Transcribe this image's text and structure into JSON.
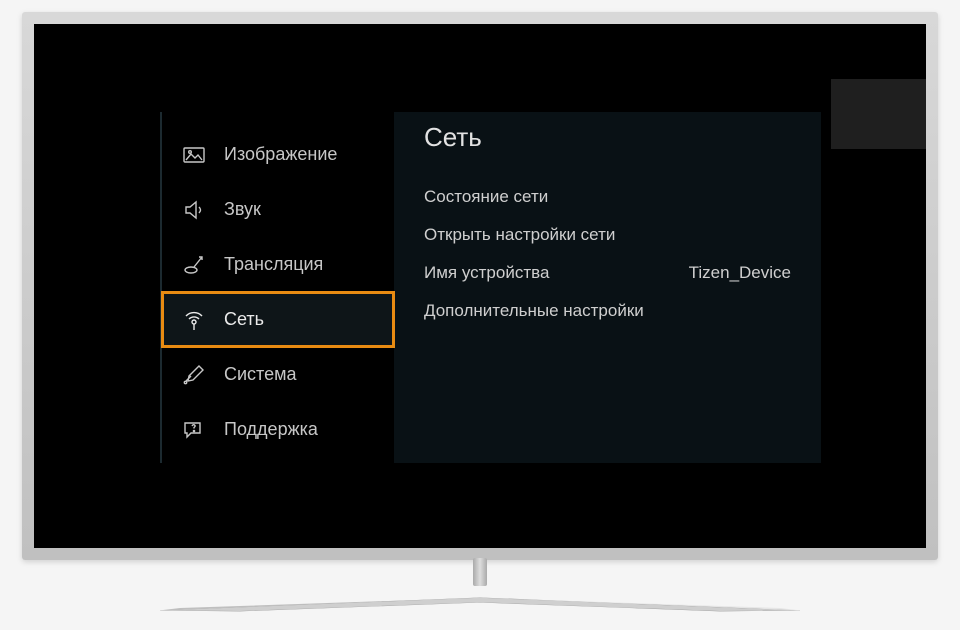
{
  "sidebar": {
    "items": [
      {
        "label": "Изображение",
        "icon": "image-icon"
      },
      {
        "label": "Звук",
        "icon": "sound-icon"
      },
      {
        "label": "Трансляция",
        "icon": "broadcast-icon"
      },
      {
        "label": "Сеть",
        "icon": "network-icon",
        "selected": true
      },
      {
        "label": "Система",
        "icon": "system-icon"
      },
      {
        "label": "Поддержка",
        "icon": "support-icon"
      }
    ]
  },
  "content": {
    "title": "Сеть",
    "items": [
      {
        "label": "Состояние сети",
        "value": ""
      },
      {
        "label": "Открыть настройки сети",
        "value": ""
      },
      {
        "label": "Имя устройства",
        "value": "Tizen_Device"
      },
      {
        "label": "Дополнительные настройки",
        "value": ""
      }
    ]
  }
}
